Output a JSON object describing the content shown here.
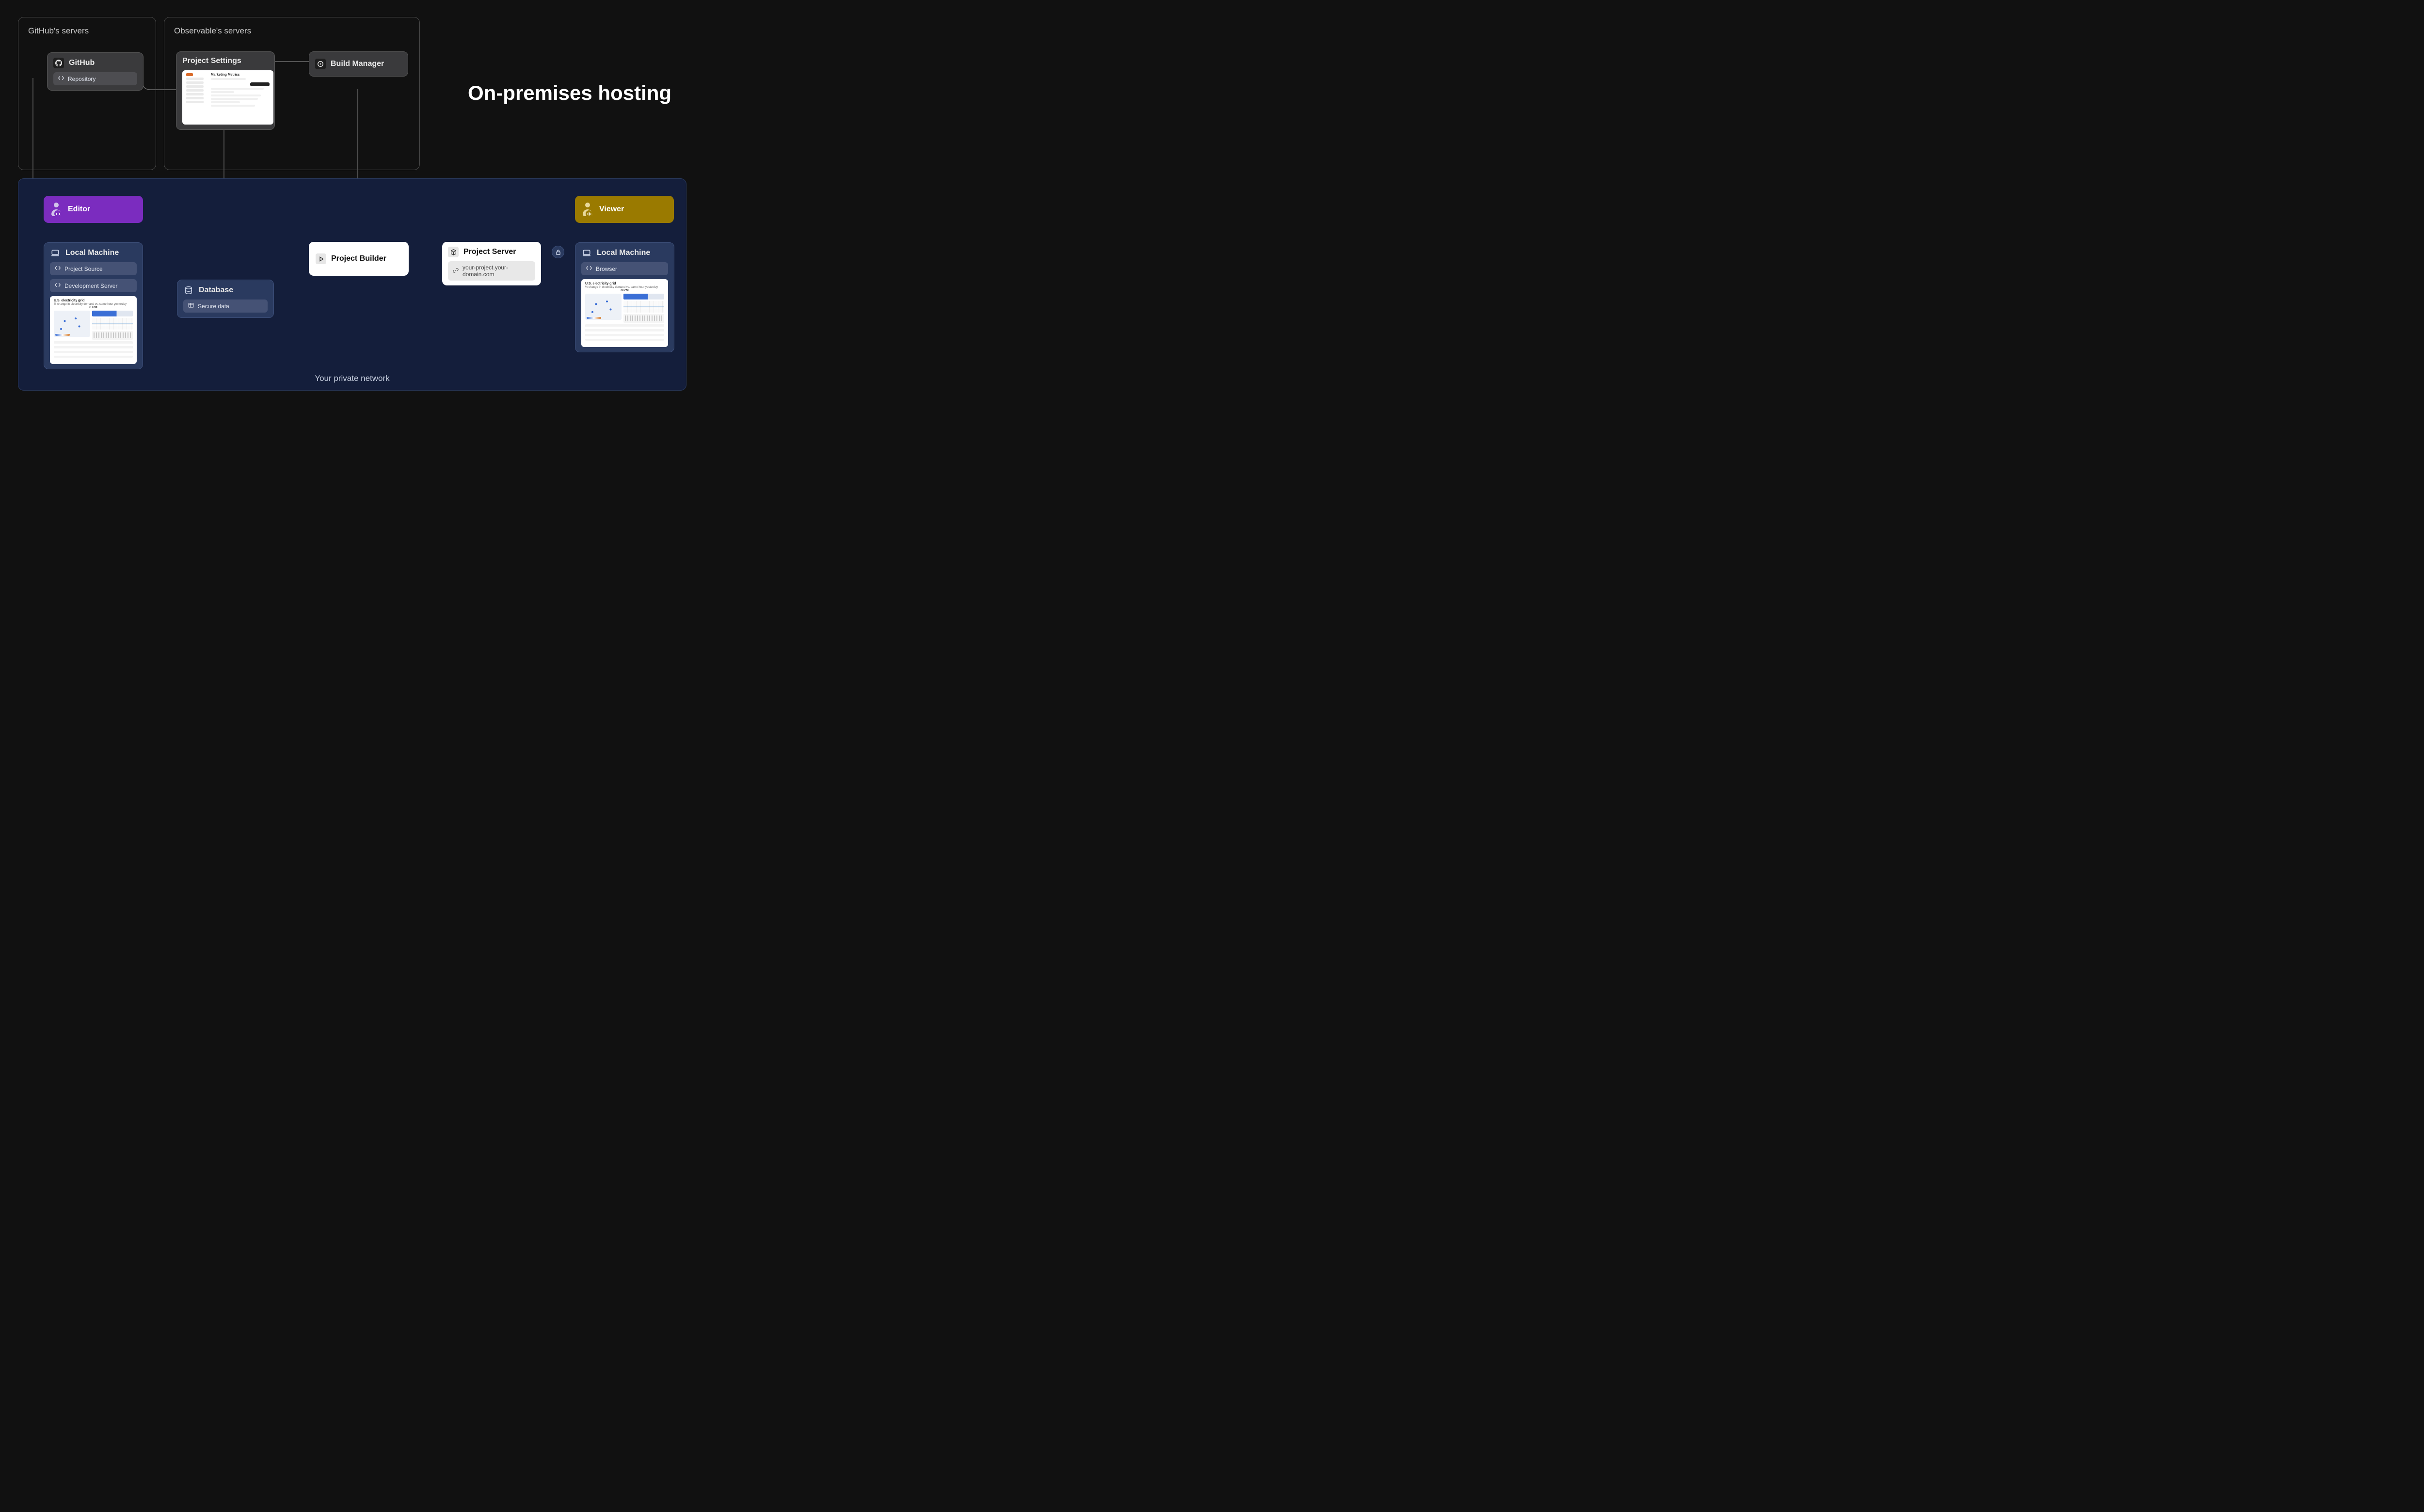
{
  "title": "On-premises hosting",
  "zones": {
    "github": "GitHub's servers",
    "observable": "Observable's servers",
    "private": "Your private network"
  },
  "nodes": {
    "github": {
      "title": "GitHub",
      "sub": "Repository"
    },
    "project_settings": {
      "title": "Project Settings",
      "screenshot_title": "Marketing Metrics"
    },
    "build_manager": {
      "title": "Build Manager"
    },
    "editor": {
      "title": "Editor"
    },
    "viewer": {
      "title": "Viewer"
    },
    "local_left": {
      "title": "Local Machine",
      "sub1": "Project Source",
      "sub2": "Development Server",
      "dash_title": "U.S. electricity grid",
      "dash_time": "8 PM"
    },
    "database": {
      "title": "Database",
      "sub": "Secure data"
    },
    "project_builder": {
      "title": "Project Builder"
    },
    "project_server": {
      "title": "Project Server",
      "url": "your-project.your-domain.com"
    },
    "local_right": {
      "title": "Local Machine",
      "sub": "Browser",
      "dash_title": "U.S. electricity grid",
      "dash_time": "8 PM"
    }
  }
}
